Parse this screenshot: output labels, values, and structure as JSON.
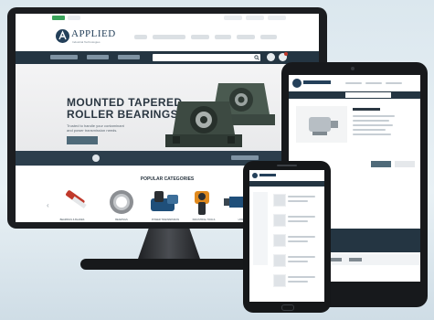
{
  "brand": {
    "name": "APPLIED",
    "tagline": "Industrial Technologies"
  },
  "hero": {
    "title_line1": "MOUNTED TAPERED",
    "title_line2": "ROLLER BEARINGS",
    "subtitle": "Trusted to handle your contaminant and power transmission needs."
  },
  "categories": {
    "title": "POPULAR CATEGORIES",
    "items": [
      "BEARINGS & BLADES",
      "BEARINGS",
      "POWER TRANSMISSION",
      "INDUSTRIAL TOOLS",
      "HYDRAULICS"
    ]
  },
  "colors": {
    "navy": "#243542",
    "slate_button": "#4f6a79",
    "accent_red": "#c0392b",
    "bearing_green": "#3d4a42"
  },
  "icons": [
    "cart-icon",
    "user-icon",
    "search-icon",
    "arrow-left-icon",
    "arrow-right-icon",
    "globe-icon"
  ]
}
